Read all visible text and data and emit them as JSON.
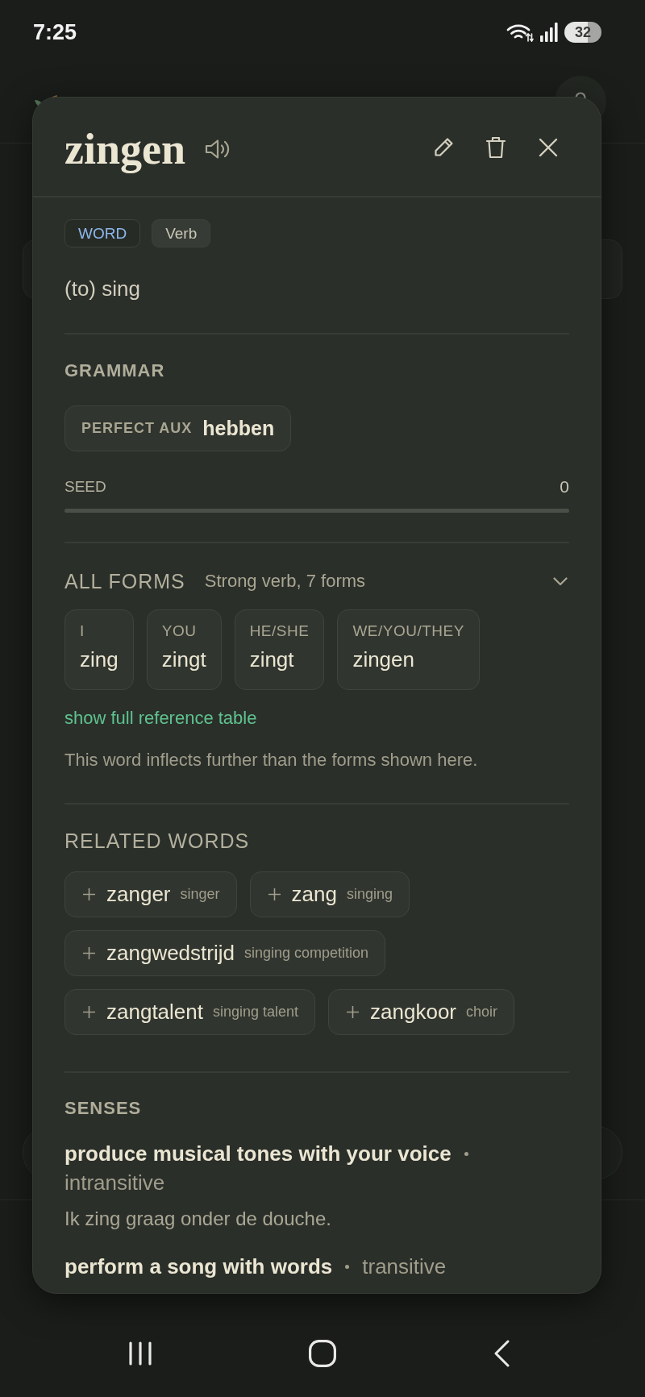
{
  "status_bar": {
    "time": "7:25",
    "battery": "32"
  },
  "dialog": {
    "word": "zingen",
    "tags": [
      {
        "label": "WORD",
        "kind": "type"
      },
      {
        "label": "Verb",
        "kind": "part_of_speech"
      }
    ],
    "translation": "(to) sing",
    "grammar": {
      "heading": "GRAMMAR",
      "items": [
        {
          "label": "PERFECT AUX",
          "value": "hebben"
        }
      ]
    },
    "seed": {
      "label": "SEED",
      "value": "0",
      "level": 0
    },
    "forms": {
      "heading": "ALL FORMS",
      "summary": "Strong verb, 7 forms",
      "items": [
        {
          "person": "I",
          "form": "zing"
        },
        {
          "person": "YOU",
          "form": "zingt"
        },
        {
          "person": "HE/SHE",
          "form": "zingt"
        },
        {
          "person": "WE/YOU/THEY",
          "form": "zingen"
        }
      ],
      "link": "show full reference table",
      "note": "This word inflects further than the forms shown here."
    },
    "related": {
      "heading": "RELATED WORDS",
      "items": [
        {
          "word": "zanger",
          "gloss": "singer"
        },
        {
          "word": "zang",
          "gloss": "singing"
        },
        {
          "word": "zangwedstrijd",
          "gloss": "singing competition"
        },
        {
          "word": "zangtalent",
          "gloss": "singing talent"
        },
        {
          "word": "zangkoor",
          "gloss": "choir"
        }
      ]
    },
    "senses": {
      "heading": "SENSES",
      "items": [
        {
          "gloss": "produce musical tones with your voice",
          "label": "intransitive",
          "example": "Ik zing graag onder de douche."
        },
        {
          "gloss": "perform a song with words",
          "label": "transitive"
        }
      ]
    }
  }
}
